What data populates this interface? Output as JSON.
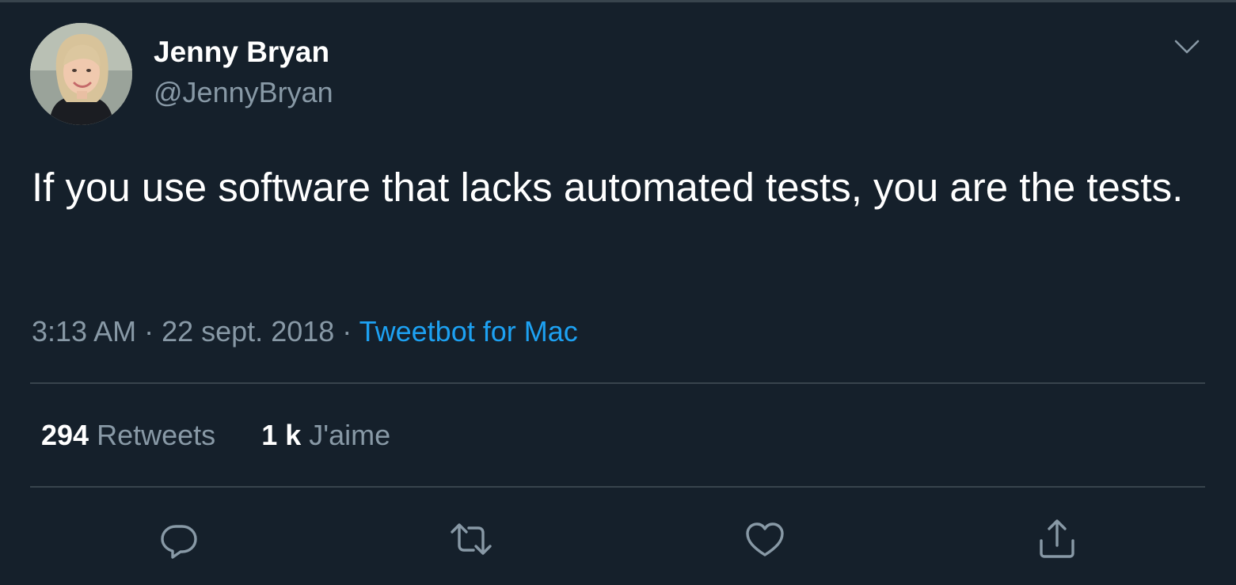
{
  "user": {
    "display_name": "Jenny Bryan",
    "handle": "@JennyBryan"
  },
  "tweet": {
    "text": "If you use software that lacks automated tests, you are the tests.",
    "time": "3:13 AM",
    "separator": " · ",
    "date": "22 sept. 2018",
    "source": "Tweetbot for Mac"
  },
  "stats": {
    "retweets_count": "294",
    "retweets_label": "Retweets",
    "likes_count": "1 k",
    "likes_label": "J'aime"
  },
  "icons": {
    "more": "chevron-down-icon",
    "reply": "reply-icon",
    "retweet": "retweet-icon",
    "like": "heart-icon",
    "share": "share-icon"
  },
  "colors": {
    "background": "#15202b",
    "primary_text": "#ffffff",
    "secondary_text": "#8899a6",
    "accent": "#1da1f2",
    "divider": "#38444d"
  }
}
